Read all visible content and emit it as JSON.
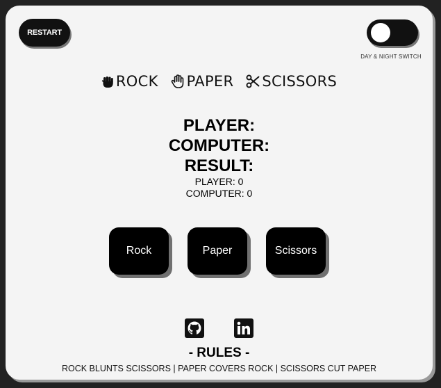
{
  "header": {
    "restart_label": "RESTART",
    "switch_label": "DAY & NIGHT SWITCH"
  },
  "title": {
    "items": [
      {
        "icon": "hand-fist-icon",
        "label": "ROCK"
      },
      {
        "icon": "hand-open-icon",
        "label": "PAPER"
      },
      {
        "icon": "scissors-icon",
        "label": "SCISSORS"
      }
    ]
  },
  "scoreboard": {
    "player_choice_label": "PLAYER:",
    "computer_choice_label": "COMPUTER:",
    "result_label": "RESULT:",
    "player_score": "PLAYER: 0",
    "computer_score": "COMPUTER: 0"
  },
  "choices": {
    "rock": "Rock",
    "paper": "Paper",
    "scissors": "Scissors"
  },
  "footer": {
    "social_icons": [
      "github-icon",
      "linkedin-icon"
    ],
    "rules_title": "- RULES -",
    "rules_text": "ROCK BLUNTS SCISSORS | PAPER COVERS ROCK | SCISSORS CUT PAPER"
  },
  "colors": {
    "background": "#222222",
    "card": "#f4f4f4",
    "button": "#000000",
    "button_text": "#ffffff"
  }
}
